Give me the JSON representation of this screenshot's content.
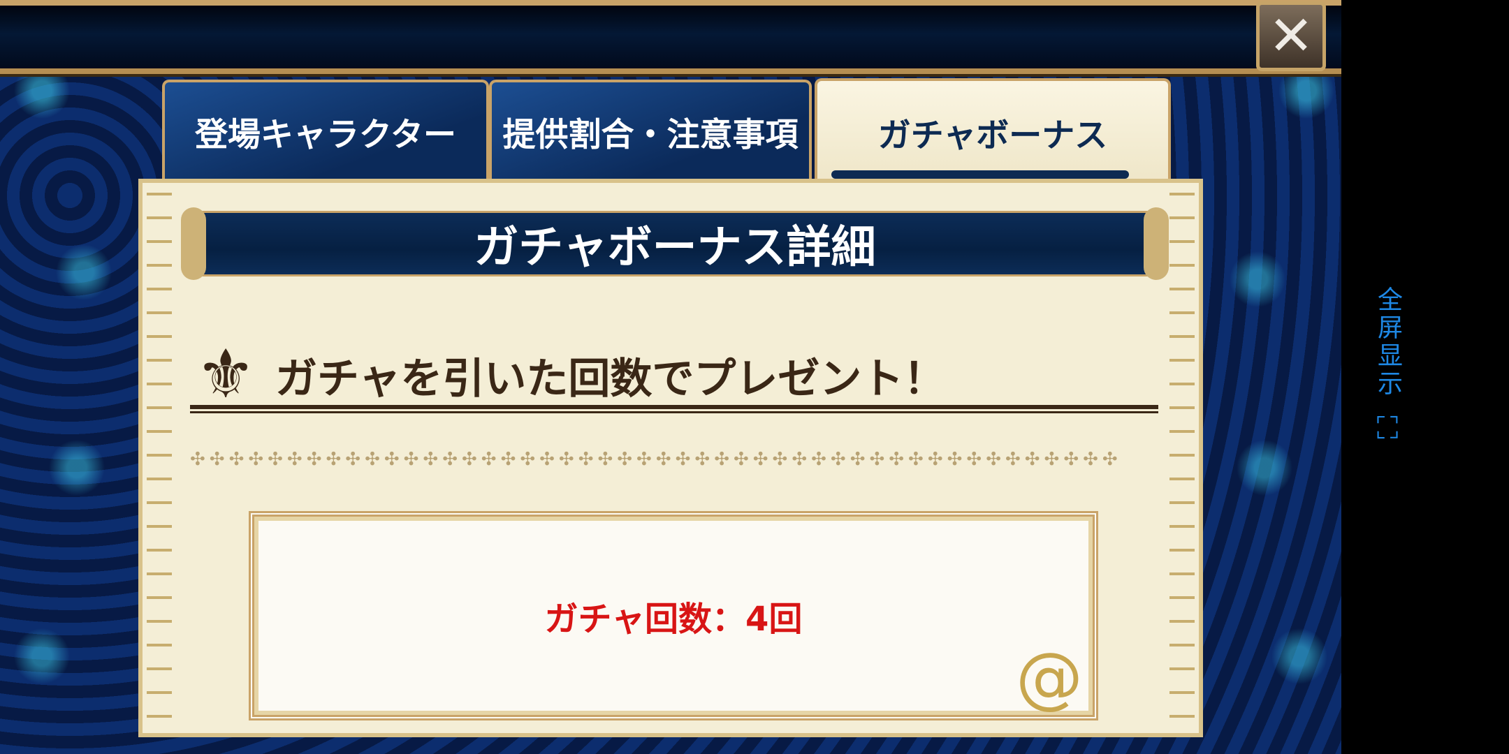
{
  "close_button": {
    "glyph": "✕"
  },
  "tabs": [
    {
      "label": "登場キャラクター",
      "active": false
    },
    {
      "label": "提供割合・注意事項",
      "active": false
    },
    {
      "label": "ガチャボーナス",
      "active": true
    }
  ],
  "panel": {
    "title": "ガチャボーナス詳細",
    "section_heading": "ガチャを引いた回数でプレゼント！",
    "divider_pattern": "✣✣✣✣✣✣✣✣✣✣✣✣✣✣✣✣✣✣✣✣✣✣✣✣✣✣✣✣✣✣✣✣✣✣✣✣✣✣✣✣✣✣✣✣✣✣✣✣",
    "gacha_count": "ガチャ回数：4回",
    "icons": [
      "fleur-de-lis-icon",
      "swirl-ornament-icon"
    ]
  },
  "side_toolbar": {
    "fullscreen_label": "全屏显示",
    "fullscreen_icon": "expand-icon",
    "color": "#1e88e5"
  },
  "colors": {
    "accent_gold": "#c9a368",
    "navy": "#0d2a52",
    "count_red": "#d81515"
  }
}
